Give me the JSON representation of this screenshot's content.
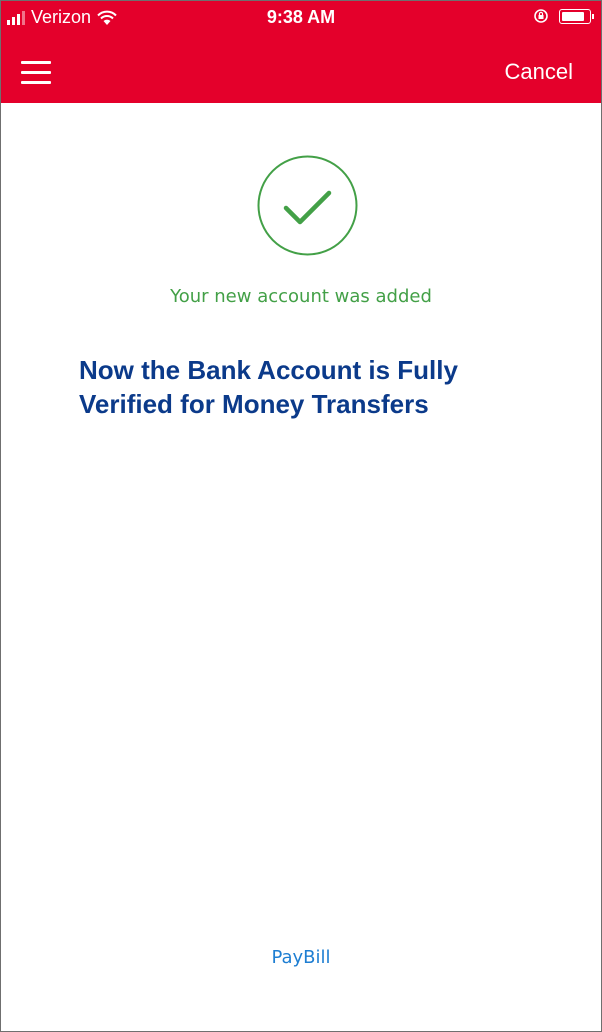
{
  "status_bar": {
    "carrier": "Verizon",
    "time": "9:38 AM",
    "icons": [
      "signal-icon",
      "wifi-icon",
      "rotation-lock-icon",
      "battery-icon"
    ]
  },
  "header": {
    "menu_icon": "hamburger-menu-icon",
    "cancel_label": "Cancel"
  },
  "success": {
    "icon": "check-circle-icon",
    "message": "Your new account was added"
  },
  "headline": {
    "line1": "Now the Bank Account is Fully",
    "line2": "Verified for Money Transfers"
  },
  "footer": {
    "link": "PayBill"
  },
  "colors": {
    "brand_red": "#e4002b",
    "success_green": "#43a047",
    "headline_blue": "#0b3a8a",
    "link_blue": "#1e7ed2"
  }
}
